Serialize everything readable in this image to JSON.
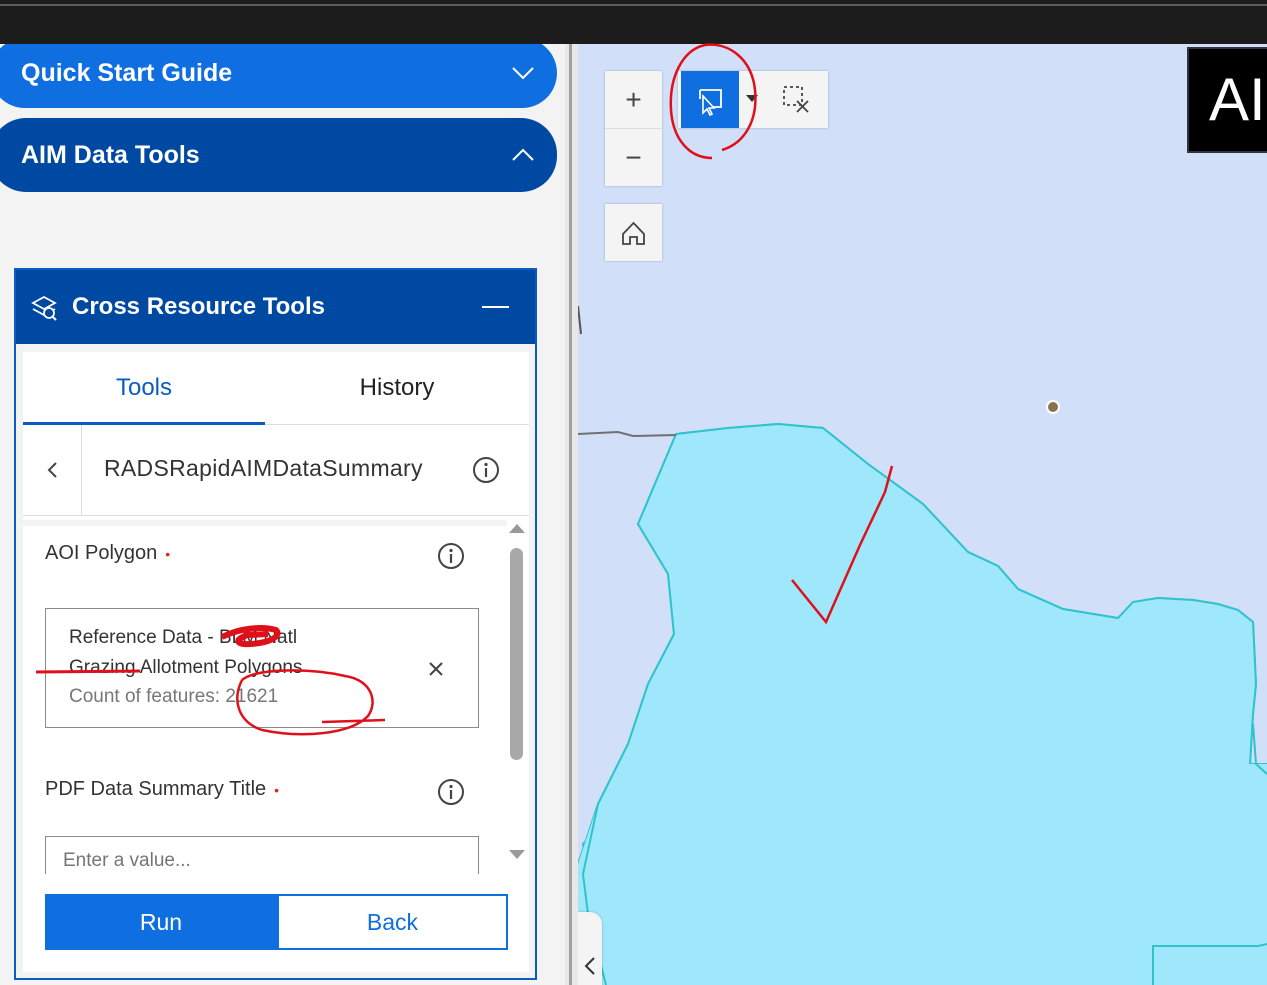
{
  "panel": {
    "accordions": [
      {
        "label": "Quick Start Guide",
        "state": "collapsed"
      },
      {
        "label": "AIM Data Tools",
        "state": "expanded"
      }
    ]
  },
  "widget": {
    "title": "Cross Resource Tools",
    "tabs": [
      {
        "label": "Tools",
        "active": true
      },
      {
        "label": "History",
        "active": false
      }
    ],
    "tool_name": "RADSRapidAIMDataSummary",
    "form": {
      "aoi": {
        "label": "AOI Polygon",
        "required_mark": "•",
        "value_line1": "Reference Data - BLM Natl",
        "value_line2": "Grazing Allotment Polygons",
        "value_line3": "Count of features: 21621"
      },
      "title_field": {
        "label": "PDF Data Summary Title",
        "required_mark": "•",
        "placeholder": "Enter a value..."
      }
    },
    "buttons": {
      "run": "Run",
      "back": "Back"
    }
  },
  "map": {
    "title_text": "AI",
    "zoom_in": "+",
    "zoom_out": "−",
    "active_tool": "select-by-rectangle",
    "colors": {
      "water": "#d1e0f8",
      "polygon_fill": "#9fe7fb",
      "polygon_stroke": "#2fc3cc",
      "accent": "#0f6fe0",
      "annotation": "#e0101a"
    }
  }
}
